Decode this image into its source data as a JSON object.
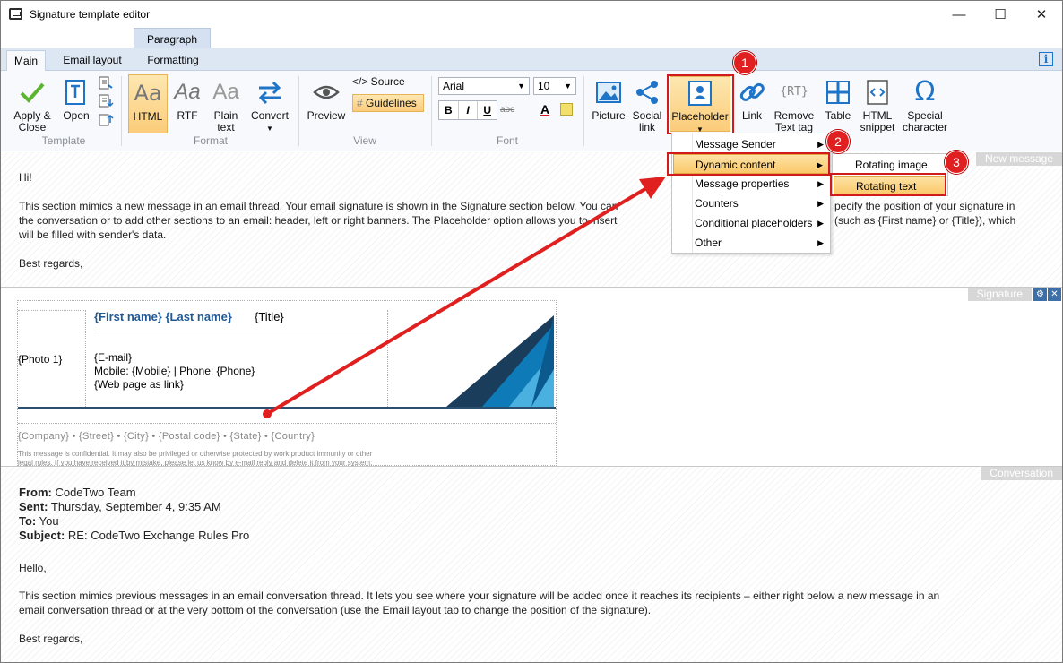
{
  "window": {
    "title": "Signature template editor",
    "minimize": "—",
    "maximize": "☐",
    "close": "✕"
  },
  "context_tab": "Paragraph",
  "tabs": [
    {
      "label": "Main",
      "active": true
    },
    {
      "label": "Email layout",
      "active": false
    },
    {
      "label": "Formatting",
      "active": false
    }
  ],
  "info": "i",
  "ribbon": {
    "groups": {
      "template": "Template",
      "format": "Format",
      "view": "View",
      "font": "Font"
    },
    "apply_close": [
      "Apply &",
      "Close"
    ],
    "open": "Open",
    "html": "HTML",
    "rtf": "RTF",
    "plain_text": [
      "Plain",
      "text"
    ],
    "convert": "Convert",
    "preview": "Preview",
    "source": "</> Source",
    "guidelines": "Guidelines",
    "font_name": "Arial",
    "font_size": "10",
    "bold": "B",
    "italic": "I",
    "underline": "U",
    "strike": "abc",
    "font_color": "A",
    "picture": "Picture",
    "social_link": [
      "Social",
      "link"
    ],
    "placeholder": "Placeholder",
    "link": "Link",
    "remove_text_tag": [
      "Remove",
      "Text tag"
    ],
    "table": "Table",
    "html_snippet": [
      "HTML",
      "snippet"
    ],
    "special_character": [
      "Special",
      "character"
    ],
    "rt": "{RT}"
  },
  "badges": [
    "1",
    "2",
    "3"
  ],
  "menu": {
    "items": [
      {
        "label": "Message Sender",
        "selected": false
      },
      {
        "label": "Dynamic content",
        "selected": true
      },
      {
        "label": "Message properties",
        "selected": false
      },
      {
        "label": "Counters",
        "selected": false
      },
      {
        "label": "Conditional placeholders",
        "selected": false
      },
      {
        "label": "Other",
        "selected": false
      }
    ],
    "arrow": "▶"
  },
  "submenu": {
    "items": [
      {
        "label": "Rotating image",
        "selected": false
      },
      {
        "label": "Rotating text",
        "selected": true
      }
    ]
  },
  "new_message": {
    "label": "New message",
    "greeting": "Hi!",
    "body_lines": [
      "This section mimics a new message in an email thread. Your email signature is shown in the Signature section below. You can",
      "the conversation or to add other sections to an email: header, left or right banners. The Placeholder option allows you to insert",
      "will be filled with sender's data."
    ],
    "body_right": [
      "pecify the position of your signature in",
      "(such as {First name} or {Title}), which"
    ],
    "closing": "Best regards,"
  },
  "signature": {
    "label": "Signature",
    "photo": "{Photo 1}",
    "name": "{First name} {Last name}",
    "title": "{Title}",
    "email": "{E-mail}",
    "phone_line": "Mobile:  {Mobile} | Phone: {Phone}",
    "web": "{Web page as link}",
    "address": "{Company} • {Street} • {City}  • {Postal code} • {State} • {Country}",
    "disclaimer_1": "This message is confidential. It may also be privileged or otherwise protected by work product immunity or other",
    "disclaimer_2": "legal rules. If you have received it by mistake, please let us know by e-mail reply and delete it from your system;",
    "name_color": "#1f5a96"
  },
  "conversation": {
    "label": "Conversation",
    "from_label": "From:",
    "from": " CodeTwo Team",
    "sent_label": "Sent:",
    "sent": " Thursday, September 4, 9:35 AM",
    "to_label": "To:",
    "to": " You",
    "subject_label": "Subject:",
    "subject": " RE: CodeTwo Exchange Rules Pro",
    "greeting": "Hello,",
    "body_lines": [
      "This section mimics previous messages in an email conversation thread. It lets you see where your signature will be added once it reaches its recipients – either right below a new message in an",
      "email conversation thread or at the very bottom of the conversation (use the Email layout tab to change the position of the signature)."
    ],
    "closing": "Best regards,"
  },
  "colors": {
    "accent_blue": "#1f74c8",
    "highlight_red": "#d11a1a",
    "menu_highlight": "#fbc86a"
  }
}
